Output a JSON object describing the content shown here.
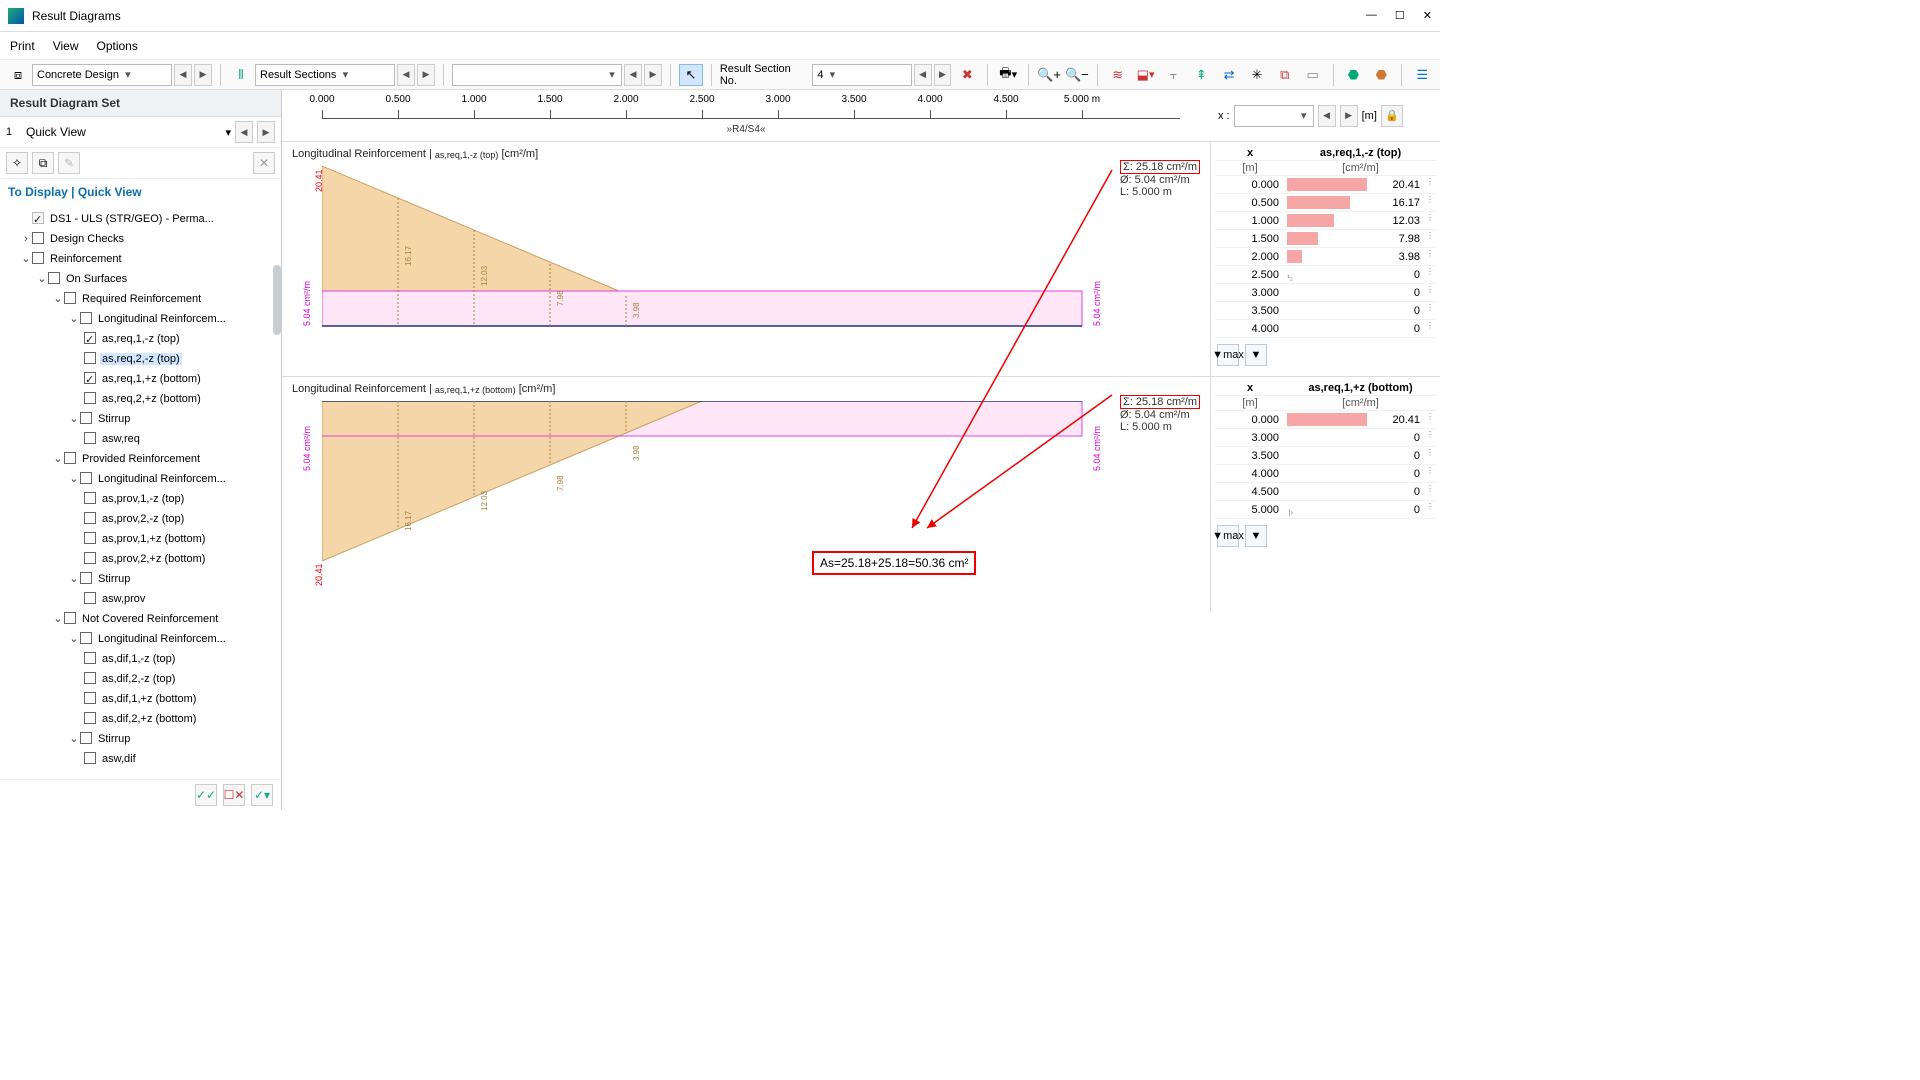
{
  "window": {
    "title": "Result Diagrams"
  },
  "menu": {
    "print": "Print",
    "view": "View",
    "options": "Options"
  },
  "toolbar": {
    "design_select": "Concrete Design",
    "sections_select": "Result Sections",
    "section_no_label": "Result Section No.",
    "section_no_value": "4",
    "unit": "[m]"
  },
  "sidebar": {
    "set_title": "Result Diagram Set",
    "quickview_index": "1",
    "quickview": "Quick View",
    "display_title": "To Display | Quick View",
    "tree": {
      "ds": "DS1 - ULS (STR/GEO) - Perma...",
      "design_checks": "Design Checks",
      "reinf": "Reinforcement",
      "on_surfaces": "On Surfaces",
      "required": "Required Reinforcement",
      "longitudinal": "Longitudinal Reinforcem...",
      "r1": "as,req,1,-z (top)",
      "r2": "as,req,2,-z (top)",
      "r3": "as,req,1,+z (bottom)",
      "r4": "as,req,2,+z (bottom)",
      "stirrup": "Stirrup",
      "asw_req": "asw,req",
      "provided": "Provided Reinforcement",
      "p1": "as,prov,1,-z (top)",
      "p2": "as,prov,2,-z (top)",
      "p3": "as,prov,1,+z (bottom)",
      "p4": "as,prov,2,+z (bottom)",
      "asw_prov": "asw,prov",
      "notcov": "Not Covered Reinforcement",
      "d1": "as,dif,1,-z (top)",
      "d2": "as,dif,2,-z (top)",
      "d3": "as,dif,1,+z (bottom)",
      "d4": "as,dif,2,+z (bottom)",
      "asw_dif": "asw,dif"
    }
  },
  "ruler": {
    "ticks": [
      "0.000",
      "0.500",
      "1.000",
      "1.500",
      "2.000",
      "2.500",
      "3.000",
      "3.500",
      "4.000",
      "4.500",
      "5.000 m"
    ],
    "sublabel": "»R4/S4«",
    "x_label": "x :"
  },
  "diagrams": {
    "top": {
      "title_pre": "Longitudinal Reinforcement | ",
      "title_var": "as,req,1,-z (top)",
      "title_unit": " [cm²/m]",
      "legend": {
        "sigma": "Σ:  25.18  cm²/m",
        "phi": "Ø:   5.04  cm²/m",
        "L": "L:   5.000  m"
      },
      "left_rot": "5.04 cm²/m",
      "right_rot": "5.04 cm²/m",
      "peak": "20.41",
      "val_labels": [
        "16.17",
        "12.03",
        "7.98",
        "3.98"
      ]
    },
    "bottom": {
      "title_pre": "Longitudinal Reinforcement | ",
      "title_var": "as,req,1,+z (bottom)",
      "title_unit": " [cm²/m]",
      "legend": {
        "sigma": "Σ:  25.18  cm²/m",
        "phi": "Ø:   5.04  cm²/m",
        "L": "L:   5.000  m"
      },
      "left_rot": "5.04 cm²/m",
      "right_rot": "5.04 cm²/m",
      "peak": "20.41",
      "val_labels": [
        "16.17",
        "12.03",
        "7.98",
        "3.98"
      ]
    },
    "callout": "As=25.18+25.18=50.36 cm²"
  },
  "tables": {
    "top": {
      "col1": "x",
      "col2": "as,req,1,-z (top)",
      "u1": "[m]",
      "u2": "[cm²/m]",
      "rows": [
        {
          "x": "0.000",
          "v": "20.41",
          "bar": 100,
          "mark": "|›"
        },
        {
          "x": "0.500",
          "v": "16.17",
          "bar": 79
        },
        {
          "x": "1.000",
          "v": "12.03",
          "bar": 59
        },
        {
          "x": "1.500",
          "v": "7.98",
          "bar": 39
        },
        {
          "x": "2.000",
          "v": "3.98",
          "bar": 19
        },
        {
          "x": "2.500",
          "v": "0",
          "bar": 0,
          "mark": "¹₂"
        },
        {
          "x": "3.000",
          "v": "0",
          "bar": 0
        },
        {
          "x": "3.500",
          "v": "0",
          "bar": 0
        },
        {
          "x": "4.000",
          "v": "0",
          "bar": 0
        }
      ]
    },
    "bottom": {
      "col1": "x",
      "col2": "as,req,1,+z (bottom)",
      "u1": "[m]",
      "u2": "[cm²/m]",
      "rows": [
        {
          "x": "0.000",
          "v": "20.41",
          "bar": 100,
          "mark": "|›"
        },
        {
          "x": "3.000",
          "v": "0",
          "bar": 0
        },
        {
          "x": "3.500",
          "v": "0",
          "bar": 0
        },
        {
          "x": "4.000",
          "v": "0",
          "bar": 0
        },
        {
          "x": "4.500",
          "v": "0",
          "bar": 0
        },
        {
          "x": "5.000",
          "v": "0",
          "bar": 0,
          "mark": "|›"
        }
      ]
    },
    "max_label": "max"
  },
  "chart_data": [
    {
      "type": "area",
      "title": "Longitudinal Reinforcement | as,req,1,-z (top) [cm²/m]",
      "x": [
        0.0,
        0.5,
        1.0,
        1.5,
        2.0,
        2.5,
        3.0,
        3.5,
        4.0,
        4.5,
        5.0
      ],
      "values": [
        20.41,
        16.17,
        12.03,
        7.98,
        3.98,
        0,
        0,
        0,
        0,
        0,
        0
      ],
      "baseline": 5.04,
      "xlabel": "x [m]",
      "ylabel": "cm²/m",
      "ylim": [
        0,
        21
      ]
    },
    {
      "type": "area",
      "title": "Longitudinal Reinforcement | as,req,1,+z (bottom) [cm²/m]",
      "x": [
        0.0,
        0.5,
        1.0,
        1.5,
        2.0,
        2.5,
        3.0,
        3.5,
        4.0,
        4.5,
        5.0
      ],
      "values": [
        20.41,
        16.17,
        12.03,
        7.98,
        3.98,
        0,
        0,
        0,
        0,
        0,
        0
      ],
      "baseline": 5.04,
      "orientation": "inverted",
      "xlabel": "x [m]",
      "ylabel": "cm²/m",
      "ylim": [
        0,
        21
      ]
    }
  ]
}
